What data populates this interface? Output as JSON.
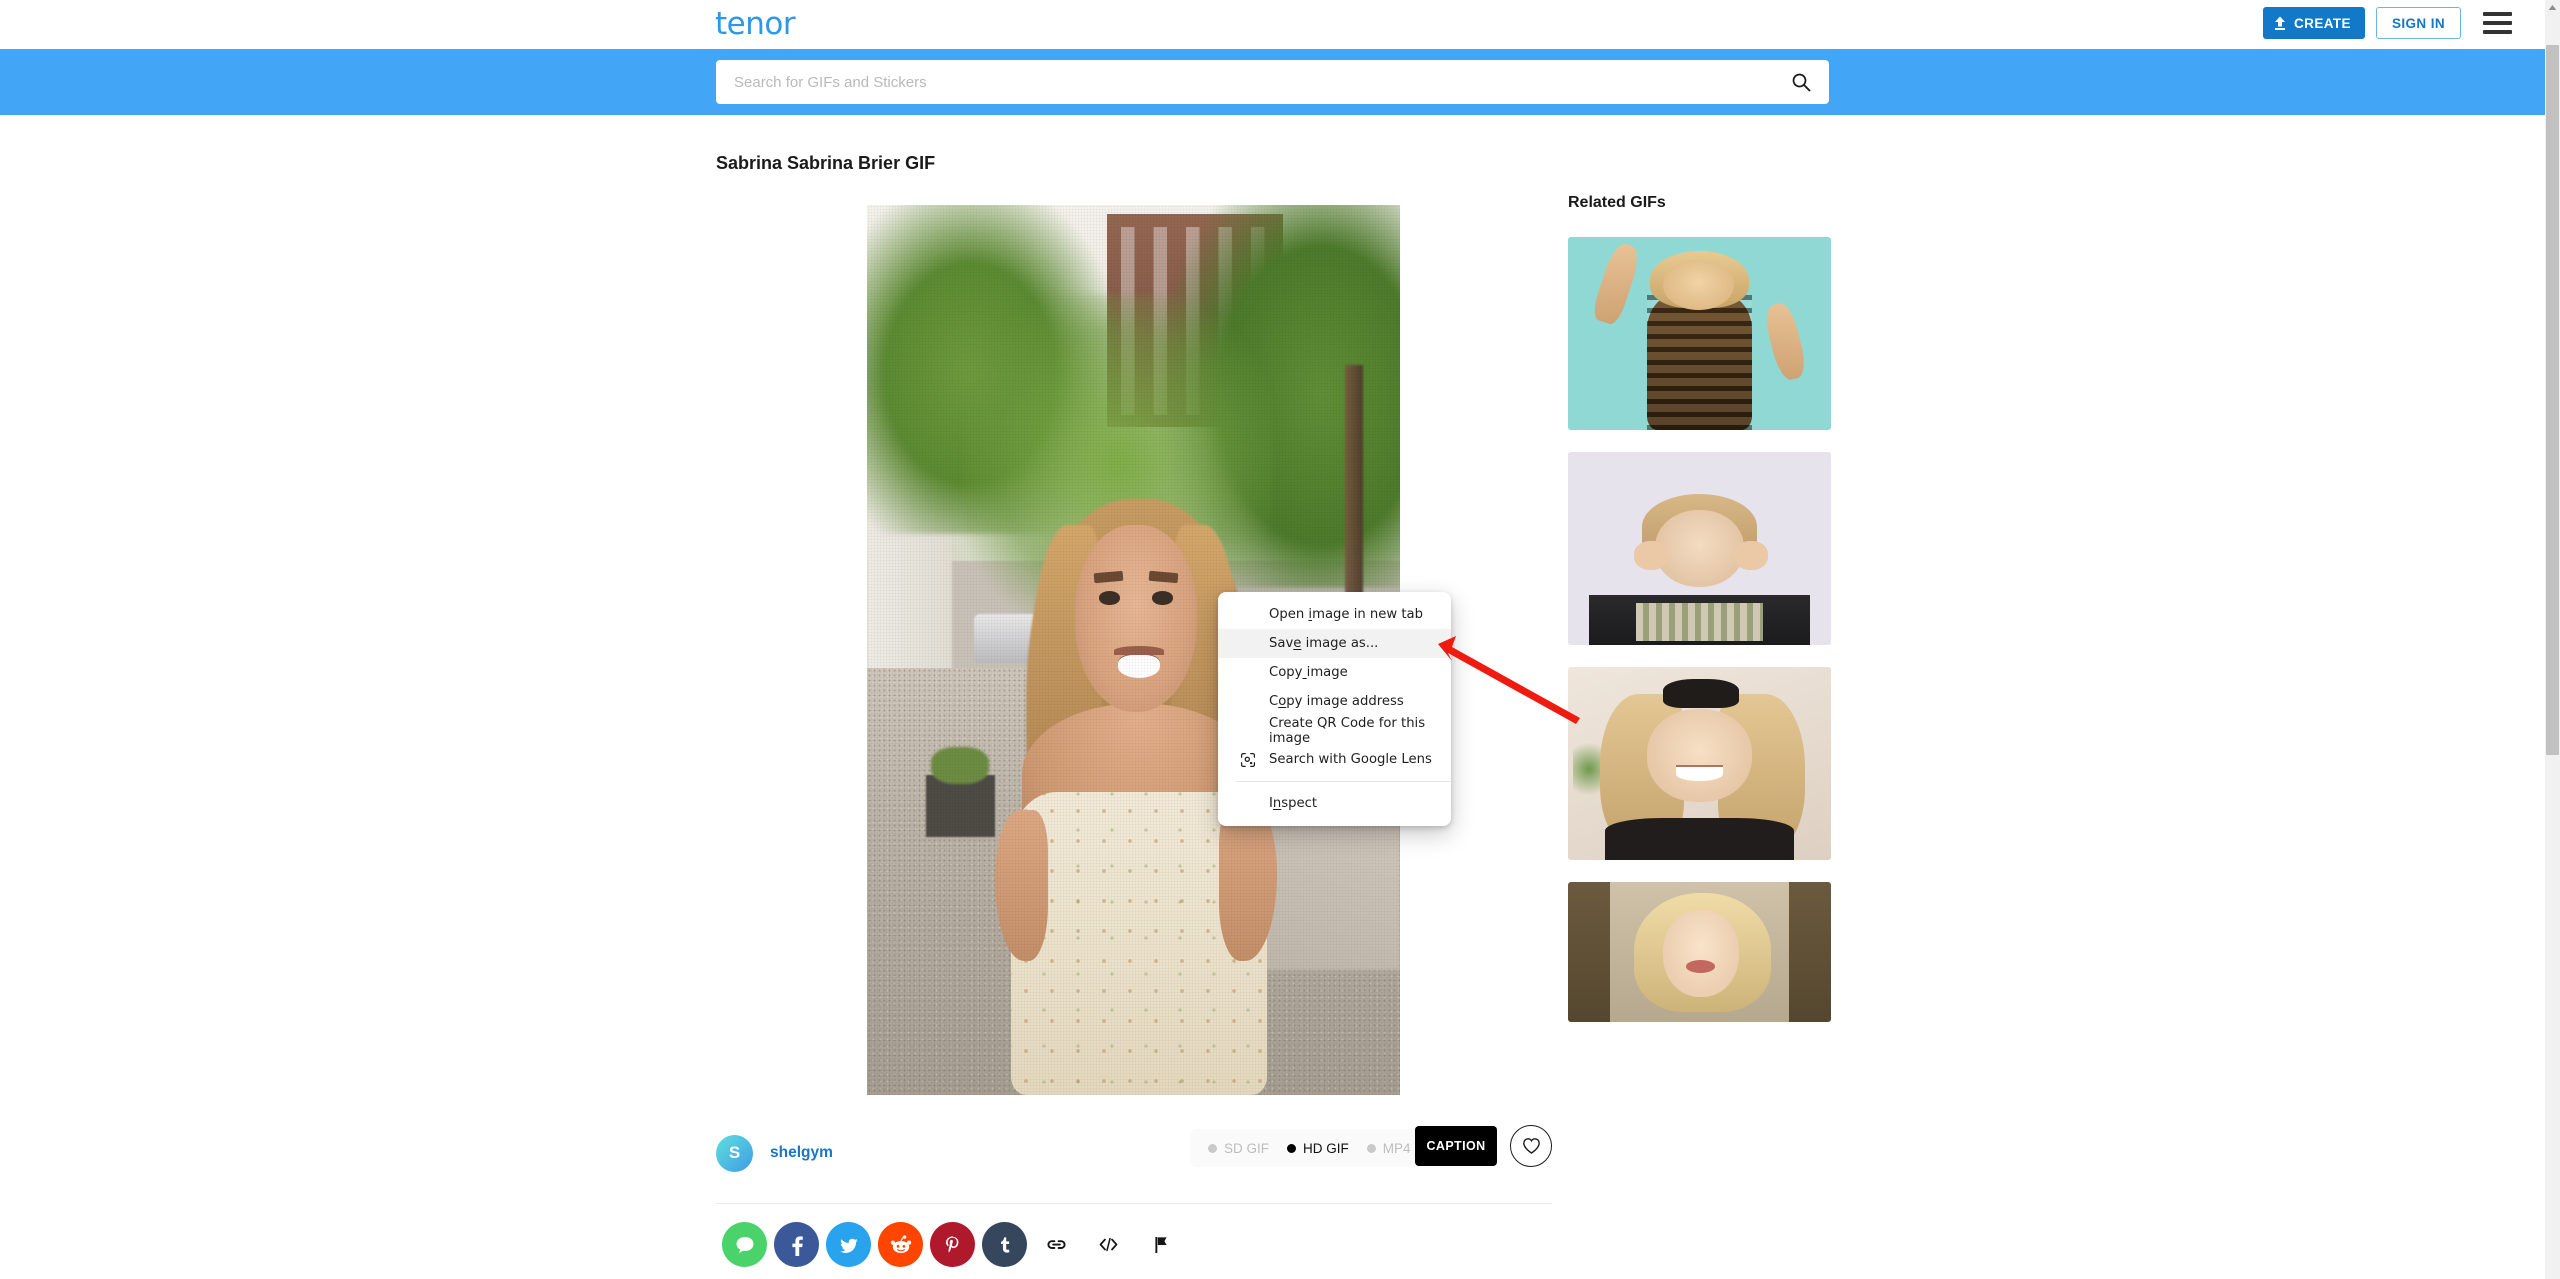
{
  "header": {
    "logo_text": "tenor",
    "create_label": "CREATE",
    "signin_label": "SIGN IN",
    "menu_icon": "hamburger-menu-icon",
    "upload_icon": "upload-arrow-icon",
    "brand_blue": "#2f97e8",
    "create_bg": "#1278c8"
  },
  "search": {
    "placeholder": "Search for GIFs and Stickers",
    "value": "",
    "icon": "search-icon",
    "band_color": "#42a5f5"
  },
  "main": {
    "page_title": "Sabrina Sabrina Brier GIF",
    "gif_alt": "Sabrina Brier walking on a city sidewalk in a floral dress"
  },
  "meta": {
    "avatar_initial": "S",
    "uploader": "shelgym",
    "formats": [
      {
        "label": "SD GIF",
        "active": false
      },
      {
        "label": "HD GIF",
        "active": true
      },
      {
        "label": "MP4",
        "active": false
      }
    ],
    "caption_label": "CAPTION",
    "favorite_icon": "heart-icon"
  },
  "share": {
    "items": [
      {
        "name": "message-share-button",
        "icon": "chat-bubble-icon",
        "color": "#4ad26b"
      },
      {
        "name": "facebook-share-button",
        "icon": "facebook-icon",
        "color": "#3b5998"
      },
      {
        "name": "twitter-share-button",
        "icon": "twitter-bird-icon",
        "color": "#2aa3ef"
      },
      {
        "name": "reddit-share-button",
        "icon": "reddit-alien-icon",
        "color": "#ff4500"
      },
      {
        "name": "pinterest-share-button",
        "icon": "pinterest-icon",
        "color": "#b0182c"
      },
      {
        "name": "tumblr-share-button",
        "icon": "tumblr-icon",
        "color": "#36465d"
      },
      {
        "name": "copy-link-button",
        "icon": "link-chain-icon",
        "color": "#ffffff"
      },
      {
        "name": "embed-code-button",
        "icon": "code-brackets-icon",
        "color": "#ffffff"
      },
      {
        "name": "report-flag-button",
        "icon": "flag-icon",
        "color": "#ffffff"
      }
    ]
  },
  "related": {
    "title": "Related GIFs",
    "items": [
      {
        "name": "related-gif-1",
        "alt": "Blonde woman dancing in a brown dress on teal background"
      },
      {
        "name": "related-gif-2",
        "alt": "Woman making a funny face with hands near eyes"
      },
      {
        "name": "related-gif-3",
        "alt": "Blonde woman smiling with eyes closed wearing black bow"
      },
      {
        "name": "related-gif-4",
        "alt": "Blonde woman blowing a kiss indoors"
      }
    ]
  },
  "context_menu": {
    "items": [
      {
        "label": "Open image in new tab",
        "accel_index": 5,
        "highlighted": false,
        "icon": null
      },
      {
        "label": "Save image as...",
        "accel_index": 3,
        "highlighted": true,
        "icon": null
      },
      {
        "label": "Copy image",
        "accel_index": 4,
        "highlighted": false,
        "icon": null
      },
      {
        "label": "Copy image address",
        "accel_index": 1,
        "highlighted": false,
        "icon": null
      },
      {
        "label": "Create QR Code for this image",
        "accel_index": -1,
        "highlighted": false,
        "icon": null
      },
      {
        "label": "Search with Google Lens",
        "accel_index": -1,
        "highlighted": false,
        "icon": "google-lens-icon"
      },
      {
        "label": "Inspect",
        "accel_index": 1,
        "highlighted": false,
        "icon": null
      }
    ],
    "highlight_color": "#f2f2f2"
  },
  "annotation": {
    "arrow_color": "#ee1c10",
    "points_at": "Save image as..."
  },
  "scrollbar": {
    "position_percent": 4
  }
}
